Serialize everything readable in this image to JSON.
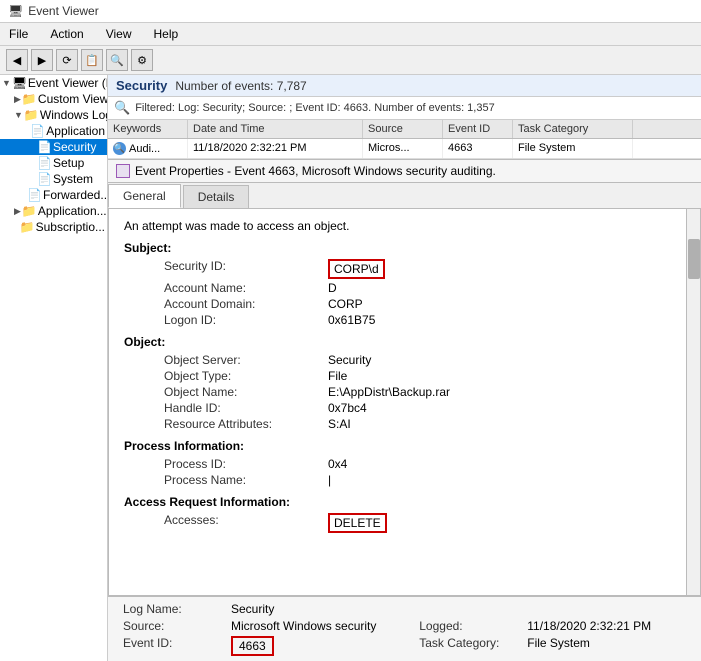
{
  "titleBar": {
    "title": "Event Viewer"
  },
  "menuBar": {
    "items": [
      "File",
      "Action",
      "View",
      "Help"
    ]
  },
  "toolbar": {
    "buttons": [
      "◀",
      "▶",
      "⟳",
      "📋",
      "🔍",
      "⚙"
    ]
  },
  "leftPanel": {
    "treeItems": [
      {
        "id": "root",
        "label": "Event Viewer (Local)",
        "level": 0,
        "expanded": true
      },
      {
        "id": "custom-views",
        "label": "Custom Views",
        "level": 1,
        "expanded": false
      },
      {
        "id": "windows-logs",
        "label": "Windows Logs",
        "level": 1,
        "expanded": true
      },
      {
        "id": "application",
        "label": "Application",
        "level": 2
      },
      {
        "id": "security",
        "label": "Security",
        "level": 2,
        "selected": true
      },
      {
        "id": "setup",
        "label": "Setup",
        "level": 2
      },
      {
        "id": "system",
        "label": "System",
        "level": 2
      },
      {
        "id": "forwarded",
        "label": "Forwarded...",
        "level": 2
      },
      {
        "id": "apps-services",
        "label": "Application...",
        "level": 1
      },
      {
        "id": "subscriptions",
        "label": "Subscriptio...",
        "level": 1
      }
    ]
  },
  "securityHeader": {
    "title": "Security",
    "eventCount": "Number of events: 7,787"
  },
  "filterBar": {
    "text": "Filtered: Log: Security; Source: ; Event ID: 4663. Number of events: 1,357"
  },
  "tableHeader": {
    "columns": [
      "Keywords",
      "Date and Time",
      "Source",
      "Event ID",
      "Task Category"
    ]
  },
  "tableRow": {
    "keyword": "Audi...",
    "dateTime": "11/18/2020 2:32:21 PM",
    "source": "Micros...",
    "eventId": "4663",
    "taskCategory": "File System"
  },
  "eventPropsHeader": {
    "title": "Event Properties - Event 4663, Microsoft Windows security auditing."
  },
  "tabs": [
    "General",
    "Details"
  ],
  "eventContent": {
    "intro": "An attempt was made to access an object.",
    "subject": {
      "label": "Subject:",
      "fields": [
        {
          "label": "Security ID:",
          "value": "CORP\\d",
          "highlight": true
        },
        {
          "label": "Account Name:",
          "value": "D"
        },
        {
          "label": "Account Domain:",
          "value": "CORP"
        },
        {
          "label": "Logon ID:",
          "value": "0x61B75"
        }
      ]
    },
    "object": {
      "label": "Object:",
      "fields": [
        {
          "label": "Object Server:",
          "value": "Security"
        },
        {
          "label": "Object Type:",
          "value": "File"
        },
        {
          "label": "Object Name:",
          "value": "E:\\AppDistr\\Backup.rar"
        },
        {
          "label": "Handle ID:",
          "value": "0x7bc4"
        },
        {
          "label": "Resource Attributes:",
          "value": "S:AI"
        }
      ]
    },
    "processInfo": {
      "label": "Process Information:",
      "fields": [
        {
          "label": "Process ID:",
          "value": "0x4"
        },
        {
          "label": "Process Name:",
          "value": "|"
        }
      ]
    },
    "accessRequest": {
      "label": "Access Request Information:",
      "fields": [
        {
          "label": "Accesses:",
          "value": "DELETE",
          "highlight": true
        }
      ]
    }
  },
  "bottomInfo": {
    "logNameLabel": "Log Name:",
    "logNameValue": "Security",
    "sourceLabel": "Source:",
    "sourceValue": "Microsoft Windows security",
    "loggedLabel": "Logged:",
    "loggedValue": "11/18/2020 2:32:21 PM",
    "eventIdLabel": "Event ID:",
    "eventIdValue": "4663",
    "taskCategoryLabel": "Task Category:",
    "taskCategoryValue": "File System"
  }
}
